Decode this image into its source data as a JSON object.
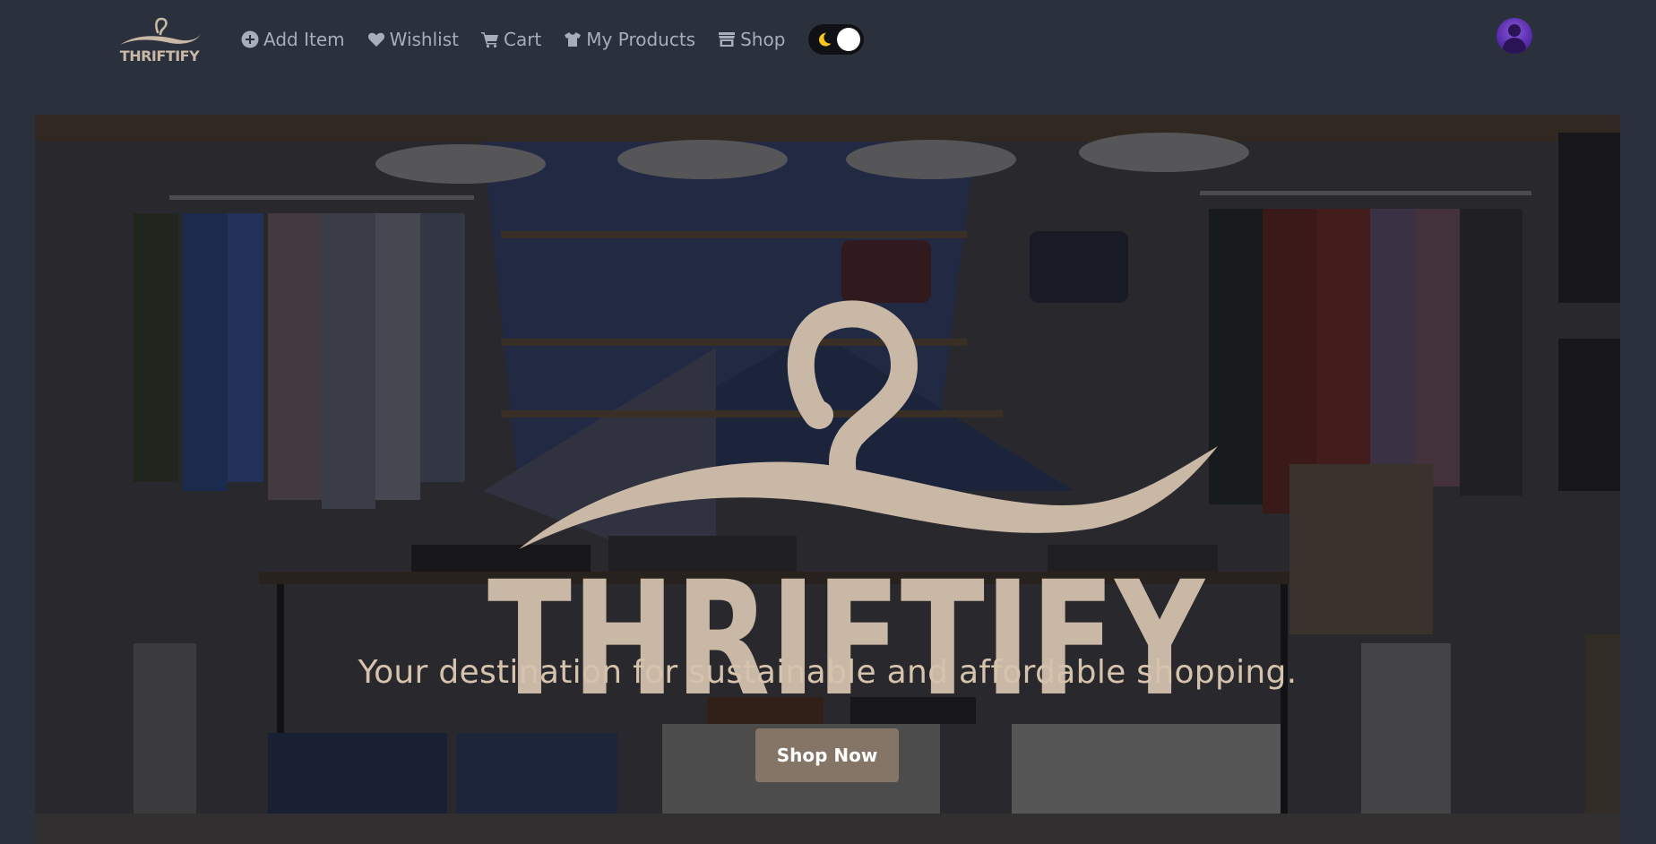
{
  "brand": {
    "name": "THRIFTIFY",
    "color": "#c9b8a6"
  },
  "nav": {
    "items": [
      {
        "label": "Add Item",
        "icon": "plus-circle-icon"
      },
      {
        "label": "Wishlist",
        "icon": "heart-icon"
      },
      {
        "label": "Cart",
        "icon": "cart-icon"
      },
      {
        "label": "My Products",
        "icon": "tshirt-icon"
      },
      {
        "label": "Shop",
        "icon": "store-icon"
      }
    ],
    "theme_toggle": {
      "icon": "moon-icon",
      "state": "dark"
    },
    "avatar_icon": "user-avatar"
  },
  "hero": {
    "logo_text": "THRIFTIFY",
    "tagline": "Your destination for sustainable and affordable shopping.",
    "cta_label": "Shop Now",
    "cta_color": "#857567",
    "tagline_color": "#d6c3ad"
  },
  "colors": {
    "background": "#2a303c",
    "nav_text": "#a6adbb"
  }
}
